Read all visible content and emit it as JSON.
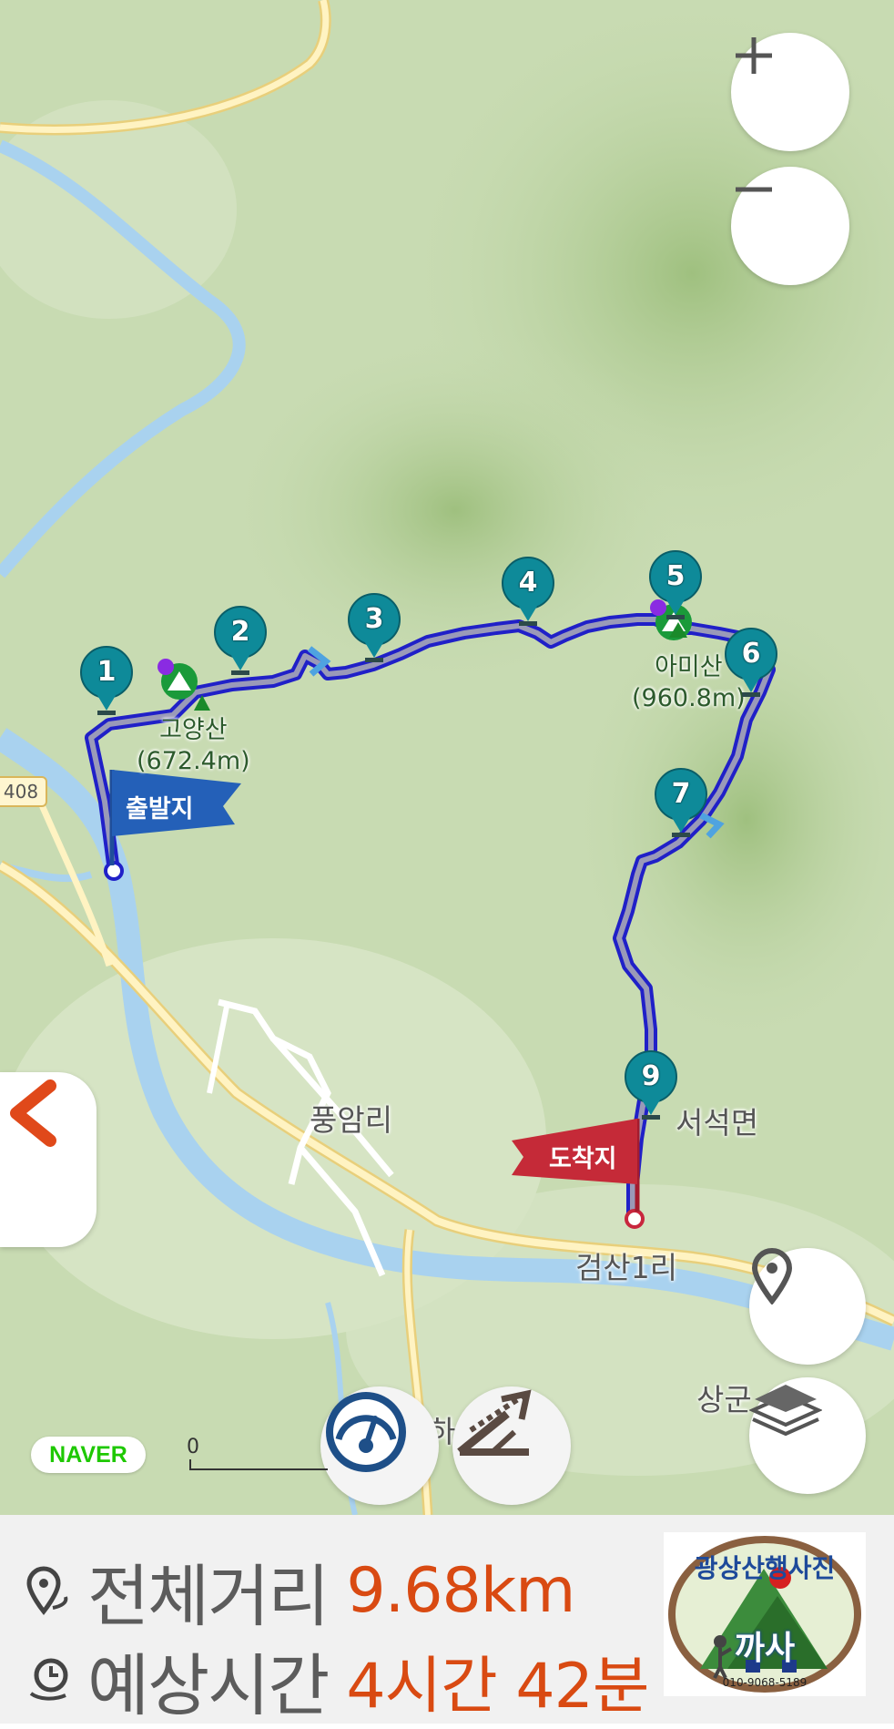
{
  "map": {
    "provider_logo": "NAVER",
    "scale_start_label": "0",
    "road_number": "408",
    "place_labels": [
      {
        "name": "pungam-ri",
        "text": "풍암리"
      },
      {
        "name": "seoseok-myeon",
        "text": "서석면"
      },
      {
        "name": "geomsan-1-ri",
        "text": "검산1리"
      },
      {
        "name": "sanggun",
        "text": "상군"
      },
      {
        "name": "partial-ha",
        "text": "하"
      }
    ],
    "peaks": [
      {
        "name": "goyangsan",
        "text": "고양산",
        "elevation": "(672.4m)"
      },
      {
        "name": "amisan",
        "text": "아미산",
        "elevation": "(960.8m)"
      }
    ],
    "start_flag": "출발지",
    "end_flag": "도착지",
    "waypoints": [
      "1",
      "2",
      "3",
      "4",
      "5",
      "6",
      "7",
      "9"
    ],
    "route_color": "#2a2ad0",
    "waypoint_color": "#0e8a99"
  },
  "controls": {
    "zoom_in_icon": "plus-icon",
    "zoom_out_icon": "minus-icon",
    "location_icon": "location-pin-icon",
    "layers_icon": "layers-icon",
    "back_icon": "chevron-left-icon",
    "speedometer_icon": "speedometer-icon",
    "elevation_icon": "elevation-profile-icon"
  },
  "summary": {
    "distance_label": "전체거리",
    "distance_value": "9.68km",
    "time_label": "예상시간",
    "time_value": "4시간 42분",
    "accent_color": "#d94a12"
  },
  "logo": {
    "text": "광상산행사진",
    "short": "까사",
    "phone": "010-9068-5189"
  }
}
